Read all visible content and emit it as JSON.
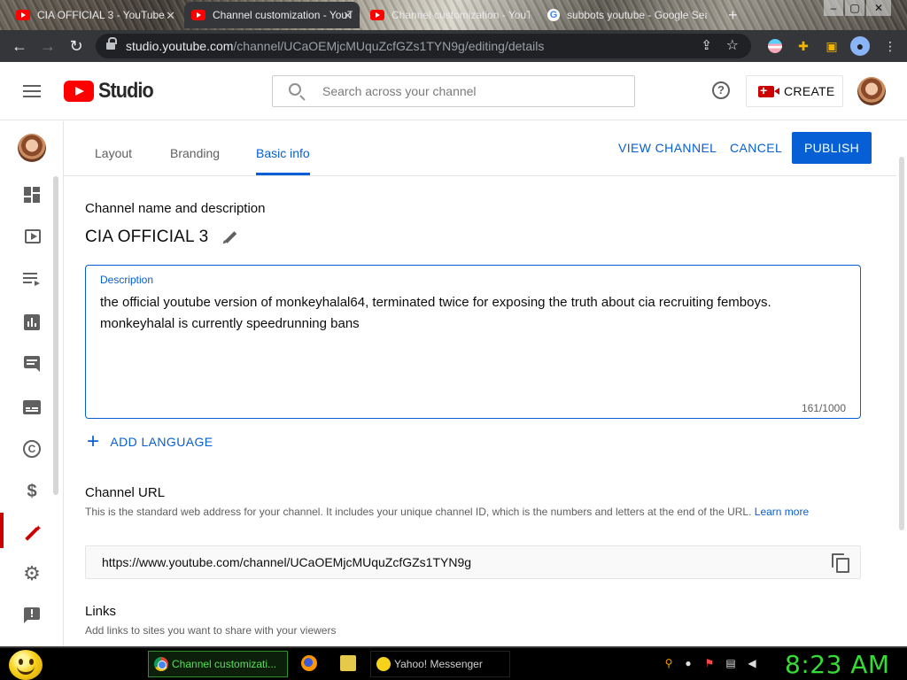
{
  "browser": {
    "tabs": [
      {
        "title": "CIA OFFICIAL 3 - YouTube",
        "active": false
      },
      {
        "title": "Channel customization - YouTube Studio",
        "active": true
      },
      {
        "title": "Channel customization - YouTube Studio",
        "active": false
      },
      {
        "title": "subbots youtube - Google Search",
        "active": false
      }
    ],
    "url_host": "studio.youtube.com",
    "url_path": "/channel/UCaOEMjcMUquZcfGZs1TYN9g/editing/details"
  },
  "header": {
    "logo_text": "Studio",
    "search_placeholder": "Search across your channel",
    "create_label": "CREATE"
  },
  "rail": {
    "items": [
      {
        "name": "dashboard",
        "active": false
      },
      {
        "name": "content",
        "active": false
      },
      {
        "name": "playlists",
        "active": false
      },
      {
        "name": "analytics",
        "active": false
      },
      {
        "name": "comments",
        "active": false
      },
      {
        "name": "subtitles",
        "active": false
      },
      {
        "name": "copyright",
        "active": false
      },
      {
        "name": "earn",
        "active": false
      },
      {
        "name": "customization",
        "active": true
      },
      {
        "name": "settings",
        "active": false
      },
      {
        "name": "send-feedback",
        "active": false
      }
    ]
  },
  "content": {
    "tabs": [
      "Layout",
      "Branding",
      "Basic info"
    ],
    "active_tab": "Basic info",
    "view_channel_label": "VIEW CHANNEL",
    "cancel_label": "CANCEL",
    "publish_label": "PUBLISH",
    "section_name_title": "Channel name and description",
    "channel_name": "CIA OFFICIAL 3",
    "description_label": "Description",
    "description_text": "the official youtube version of monkeyhalal64, terminated twice for exposing the truth about cia recruiting femboys. monkeyhalal is currently speedrunning bans",
    "description_count": "161/1000",
    "add_language_label": "ADD LANGUAGE",
    "url_title": "Channel URL",
    "url_help": "This is the standard web address for your channel. It includes your unique channel ID, which is the numbers and letters at the end of the URL.",
    "url_help_link": "Learn more",
    "channel_url": "https://www.youtube.com/channel/UCaOEMjcMUquZcfGZs1TYN9g",
    "links_title": "Links",
    "links_help": "Add links to sites you want to share with your viewers"
  },
  "taskbar": {
    "items": [
      {
        "label": "Channel customizati...",
        "active": true
      },
      {
        "label": "Yahoo! Messenger",
        "active": false
      }
    ],
    "clock": "8:23 AM"
  },
  "colors": {
    "accent": "#065fd4",
    "brand_red": "#ff0000",
    "clock_green": "#33dd33"
  }
}
